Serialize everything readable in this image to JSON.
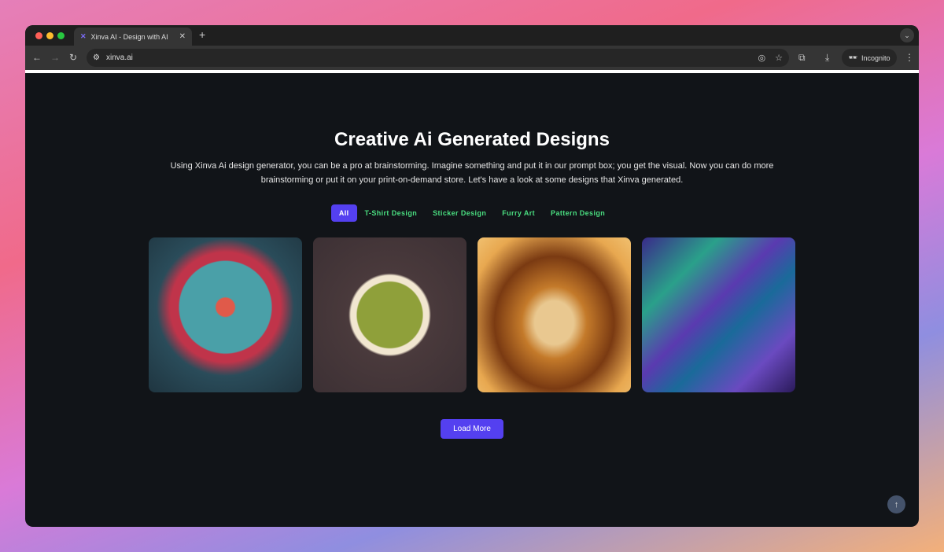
{
  "browser": {
    "tab_title": "Xinva AI - Design with AI",
    "url": "xinva.ai",
    "incognito_label": "Incognito"
  },
  "hero": {
    "title": "Creative Ai Generated Designs",
    "description": "Using Xinva Ai design generator, you can be a pro at brainstorming. Imagine something and put it in our prompt box; you get the visual. Now you can do more brainstorming or put it on your print-on-demand store. Let's have a look at some designs that Xinva generated."
  },
  "filters": [
    {
      "label": "All",
      "active": true
    },
    {
      "label": "T-Shirt Design"
    },
    {
      "label": "Sticker Design"
    },
    {
      "label": "Furry Art"
    },
    {
      "label": "Pattern Design"
    }
  ],
  "gallery": [
    {
      "subject": "teal monster"
    },
    {
      "subject": "orc sticker"
    },
    {
      "subject": "lion"
    },
    {
      "subject": "geometric pattern"
    }
  ],
  "load_more_label": "Load More",
  "colors": {
    "accent": "#5440f0",
    "filter_text": "#4ade80",
    "background": "#111418"
  }
}
